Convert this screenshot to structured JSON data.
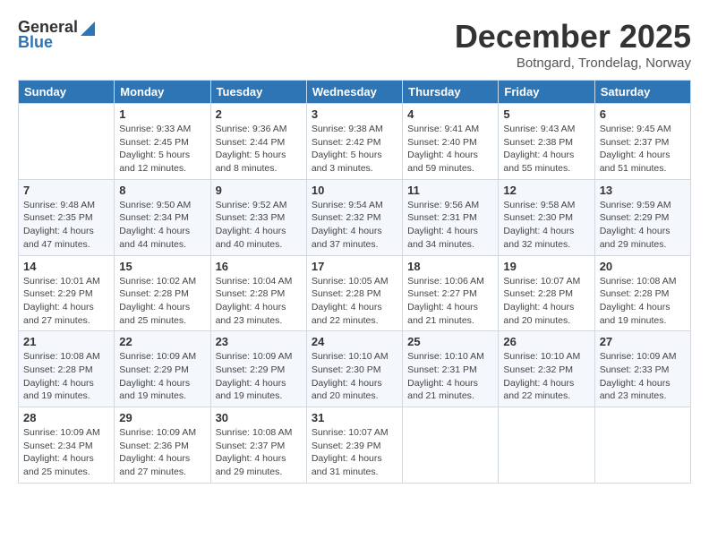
{
  "logo": {
    "general": "General",
    "blue": "Blue"
  },
  "title": "December 2025",
  "subtitle": "Botngard, Trondelag, Norway",
  "days_of_week": [
    "Sunday",
    "Monday",
    "Tuesday",
    "Wednesday",
    "Thursday",
    "Friday",
    "Saturday"
  ],
  "weeks": [
    [
      {
        "day": "",
        "info": ""
      },
      {
        "day": "1",
        "info": "Sunrise: 9:33 AM\nSunset: 2:45 PM\nDaylight: 5 hours\nand 12 minutes."
      },
      {
        "day": "2",
        "info": "Sunrise: 9:36 AM\nSunset: 2:44 PM\nDaylight: 5 hours\nand 8 minutes."
      },
      {
        "day": "3",
        "info": "Sunrise: 9:38 AM\nSunset: 2:42 PM\nDaylight: 5 hours\nand 3 minutes."
      },
      {
        "day": "4",
        "info": "Sunrise: 9:41 AM\nSunset: 2:40 PM\nDaylight: 4 hours\nand 59 minutes."
      },
      {
        "day": "5",
        "info": "Sunrise: 9:43 AM\nSunset: 2:38 PM\nDaylight: 4 hours\nand 55 minutes."
      },
      {
        "day": "6",
        "info": "Sunrise: 9:45 AM\nSunset: 2:37 PM\nDaylight: 4 hours\nand 51 minutes."
      }
    ],
    [
      {
        "day": "7",
        "info": "Sunrise: 9:48 AM\nSunset: 2:35 PM\nDaylight: 4 hours\nand 47 minutes."
      },
      {
        "day": "8",
        "info": "Sunrise: 9:50 AM\nSunset: 2:34 PM\nDaylight: 4 hours\nand 44 minutes."
      },
      {
        "day": "9",
        "info": "Sunrise: 9:52 AM\nSunset: 2:33 PM\nDaylight: 4 hours\nand 40 minutes."
      },
      {
        "day": "10",
        "info": "Sunrise: 9:54 AM\nSunset: 2:32 PM\nDaylight: 4 hours\nand 37 minutes."
      },
      {
        "day": "11",
        "info": "Sunrise: 9:56 AM\nSunset: 2:31 PM\nDaylight: 4 hours\nand 34 minutes."
      },
      {
        "day": "12",
        "info": "Sunrise: 9:58 AM\nSunset: 2:30 PM\nDaylight: 4 hours\nand 32 minutes."
      },
      {
        "day": "13",
        "info": "Sunrise: 9:59 AM\nSunset: 2:29 PM\nDaylight: 4 hours\nand 29 minutes."
      }
    ],
    [
      {
        "day": "14",
        "info": "Sunrise: 10:01 AM\nSunset: 2:29 PM\nDaylight: 4 hours\nand 27 minutes."
      },
      {
        "day": "15",
        "info": "Sunrise: 10:02 AM\nSunset: 2:28 PM\nDaylight: 4 hours\nand 25 minutes."
      },
      {
        "day": "16",
        "info": "Sunrise: 10:04 AM\nSunset: 2:28 PM\nDaylight: 4 hours\nand 23 minutes."
      },
      {
        "day": "17",
        "info": "Sunrise: 10:05 AM\nSunset: 2:28 PM\nDaylight: 4 hours\nand 22 minutes."
      },
      {
        "day": "18",
        "info": "Sunrise: 10:06 AM\nSunset: 2:27 PM\nDaylight: 4 hours\nand 21 minutes."
      },
      {
        "day": "19",
        "info": "Sunrise: 10:07 AM\nSunset: 2:28 PM\nDaylight: 4 hours\nand 20 minutes."
      },
      {
        "day": "20",
        "info": "Sunrise: 10:08 AM\nSunset: 2:28 PM\nDaylight: 4 hours\nand 19 minutes."
      }
    ],
    [
      {
        "day": "21",
        "info": "Sunrise: 10:08 AM\nSunset: 2:28 PM\nDaylight: 4 hours\nand 19 minutes."
      },
      {
        "day": "22",
        "info": "Sunrise: 10:09 AM\nSunset: 2:29 PM\nDaylight: 4 hours\nand 19 minutes."
      },
      {
        "day": "23",
        "info": "Sunrise: 10:09 AM\nSunset: 2:29 PM\nDaylight: 4 hours\nand 19 minutes."
      },
      {
        "day": "24",
        "info": "Sunrise: 10:10 AM\nSunset: 2:30 PM\nDaylight: 4 hours\nand 20 minutes."
      },
      {
        "day": "25",
        "info": "Sunrise: 10:10 AM\nSunset: 2:31 PM\nDaylight: 4 hours\nand 21 minutes."
      },
      {
        "day": "26",
        "info": "Sunrise: 10:10 AM\nSunset: 2:32 PM\nDaylight: 4 hours\nand 22 minutes."
      },
      {
        "day": "27",
        "info": "Sunrise: 10:09 AM\nSunset: 2:33 PM\nDaylight: 4 hours\nand 23 minutes."
      }
    ],
    [
      {
        "day": "28",
        "info": "Sunrise: 10:09 AM\nSunset: 2:34 PM\nDaylight: 4 hours\nand 25 minutes."
      },
      {
        "day": "29",
        "info": "Sunrise: 10:09 AM\nSunset: 2:36 PM\nDaylight: 4 hours\nand 27 minutes."
      },
      {
        "day": "30",
        "info": "Sunrise: 10:08 AM\nSunset: 2:37 PM\nDaylight: 4 hours\nand 29 minutes."
      },
      {
        "day": "31",
        "info": "Sunrise: 10:07 AM\nSunset: 2:39 PM\nDaylight: 4 hours\nand 31 minutes."
      },
      {
        "day": "",
        "info": ""
      },
      {
        "day": "",
        "info": ""
      },
      {
        "day": "",
        "info": ""
      }
    ]
  ]
}
